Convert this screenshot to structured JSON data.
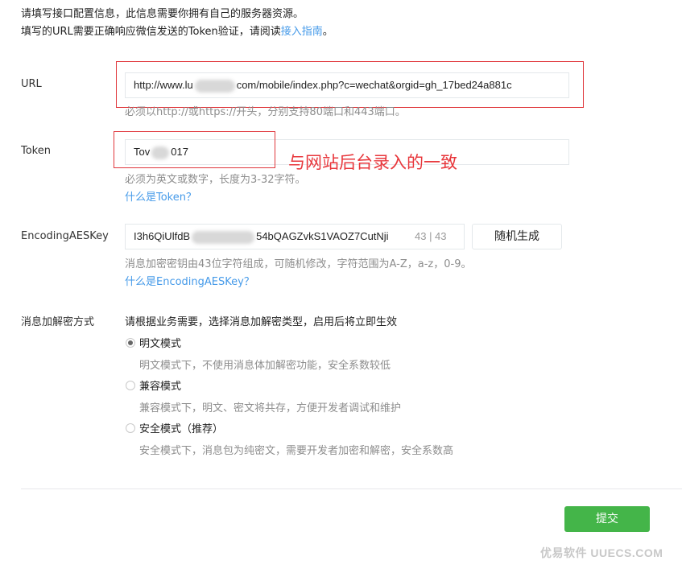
{
  "intro": {
    "line1": "请填写接口配置信息，此信息需要你拥有自己的服务器资源。",
    "line2_prefix": "填写的URL需要正确响应微信发送的Token验证，请阅读",
    "line2_link": "接入指南",
    "line2_suffix": "。"
  },
  "url": {
    "label": "URL",
    "value_prefix": "http://www.lu",
    "value_suffix": "com/mobile/index.php?c=wechat&orgid=gh_17bed24a881c",
    "hint": "必须以http://或https://开头，分别支持80端口和443端口。"
  },
  "token": {
    "label": "Token",
    "value_prefix": "Tov",
    "value_suffix": "017",
    "hint": "必须为英文或数字，长度为3-32字符。",
    "help_link": "什么是Token？"
  },
  "annotation": "与网站后台录入的一致",
  "aes": {
    "label": "EncodingAESKey",
    "value_prefix": "I3h6QiUlfdB",
    "value_suffix": "54bQAGZvkS1VAOZ7CutNji",
    "counter": "43 | 43",
    "random_button": "随机生成",
    "hint": "消息加密密钥由43位字符组成，可随机修改，字符范围为A-Z，a-z，0-9。",
    "help_link": "什么是EncodingAESKey？"
  },
  "encryption": {
    "label": "消息加解密方式",
    "intro": "请根据业务需要，选择消息加解密类型，启用后将立即生效",
    "options": [
      {
        "label": "明文模式",
        "desc": "明文模式下，不使用消息体加解密功能，安全系数较低",
        "checked": true
      },
      {
        "label": "兼容模式",
        "desc": "兼容模式下，明文、密文将共存，方便开发者调试和维护",
        "checked": false
      },
      {
        "label": "安全模式（推荐）",
        "desc": "安全模式下，消息包为纯密文，需要开发者加密和解密，安全系数高",
        "checked": false
      }
    ]
  },
  "submit_button": "提交",
  "watermark": "优易软件 UUECS.COM"
}
